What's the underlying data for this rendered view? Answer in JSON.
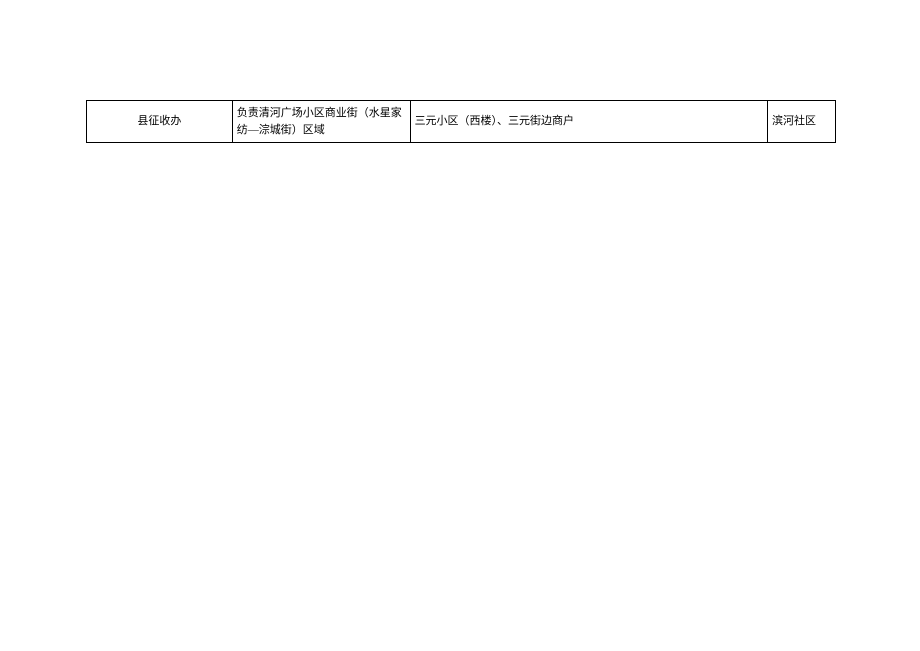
{
  "table": {
    "rows": [
      {
        "col1": "县征收办",
        "col2": "负责清河广场小区商业街（水星家纺—淙城街）区域",
        "col3": "三元小区（西楼）、三元街边商户",
        "col4": "滨河社区"
      }
    ]
  }
}
